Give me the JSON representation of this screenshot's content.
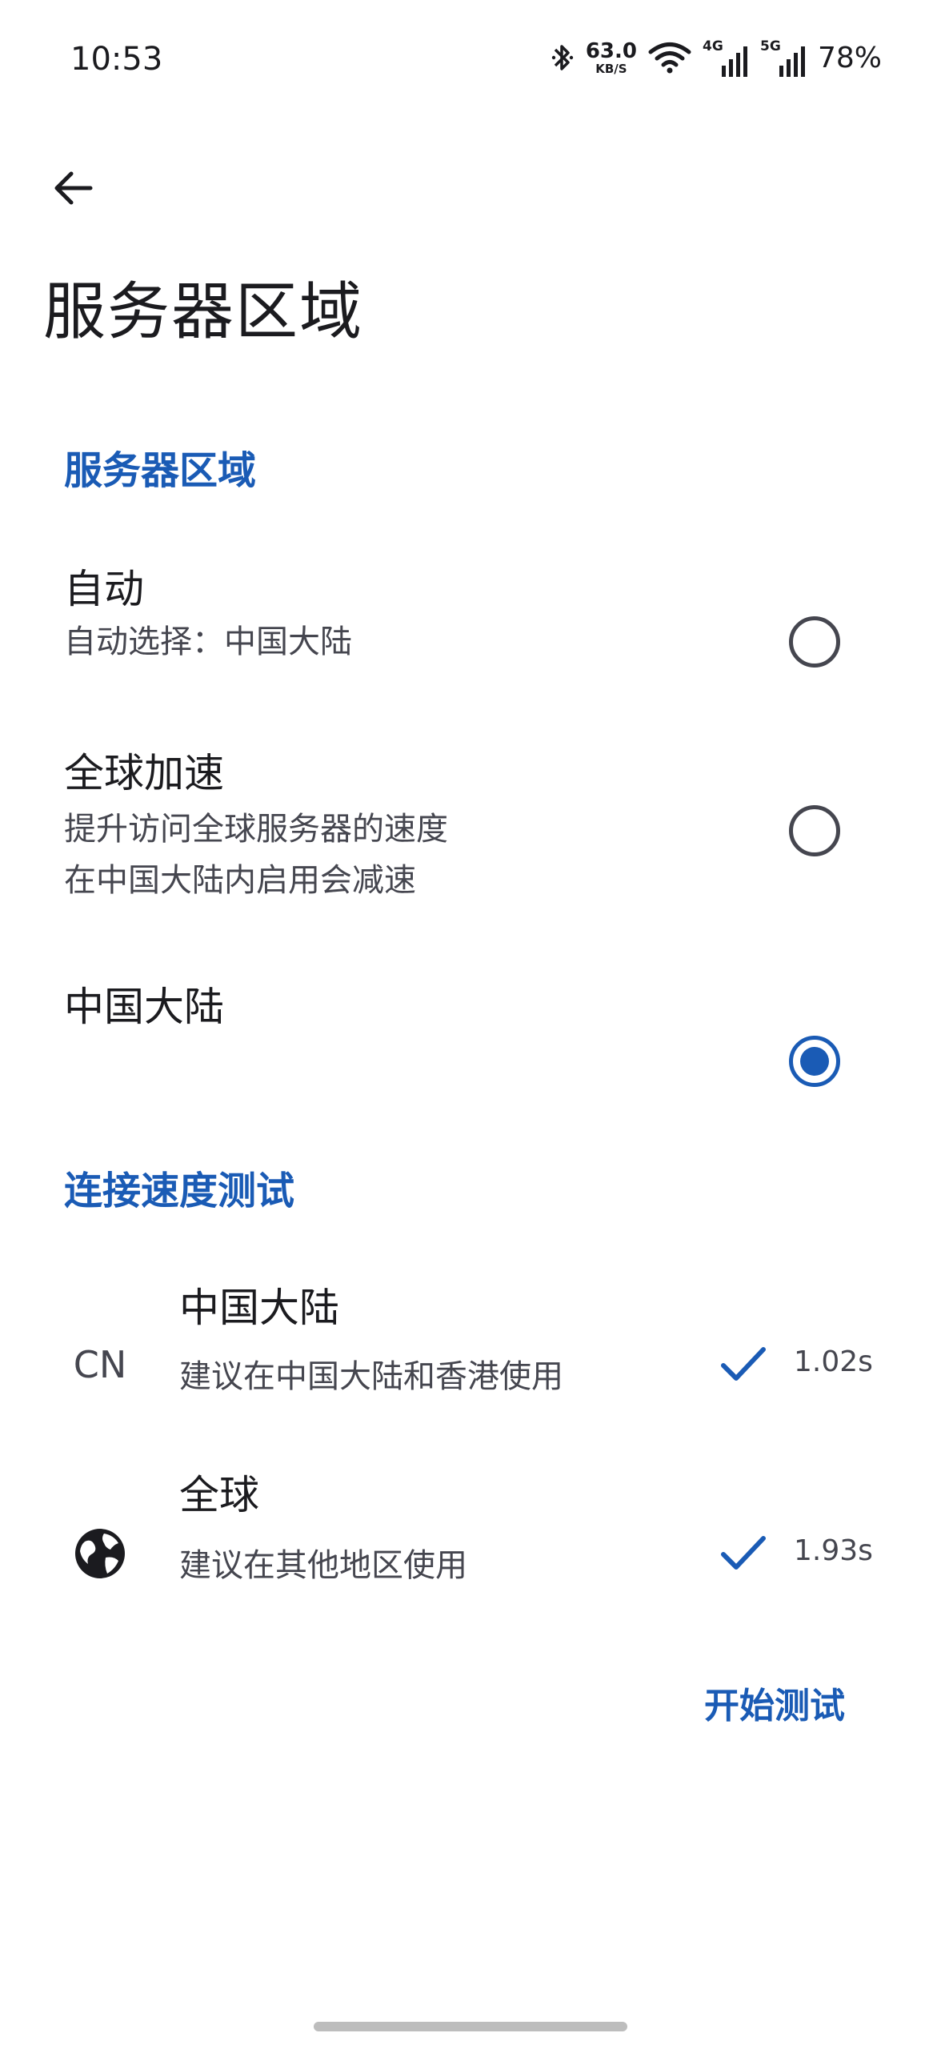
{
  "status_bar": {
    "time": "10:53",
    "net_speed_value": "63.0",
    "net_speed_unit": "KB/S",
    "signal_1_label": "4G",
    "signal_2_label": "5G",
    "battery": "78%"
  },
  "header": {
    "title": "服务器区域"
  },
  "server_region": {
    "section_title": "服务器区域",
    "options": [
      {
        "title": "自动",
        "description": "自动选择：中国大陆",
        "selected": false
      },
      {
        "title": "全球加速",
        "description": "提升访问全球服务器的速度\n在中国大陆内启用会减速",
        "selected": false
      },
      {
        "title": "中国大陆",
        "description": "",
        "selected": true
      }
    ]
  },
  "speed_test": {
    "section_title": "连接速度测试",
    "items": [
      {
        "lead_text": "CN",
        "title": "中国大陆",
        "description": "建议在中国大陆和香港使用",
        "time": "1.02s",
        "status_icon": "check-icon"
      },
      {
        "lead_icon": "globe-icon",
        "title": "全球",
        "description": "建议在其他地区使用",
        "time": "1.93s",
        "status_icon": "check-icon"
      }
    ],
    "start_button_label": "开始测试"
  },
  "colors": {
    "accent": "#1a5bb5",
    "text_primary": "#1b1b1f",
    "text_secondary": "#45464f"
  }
}
